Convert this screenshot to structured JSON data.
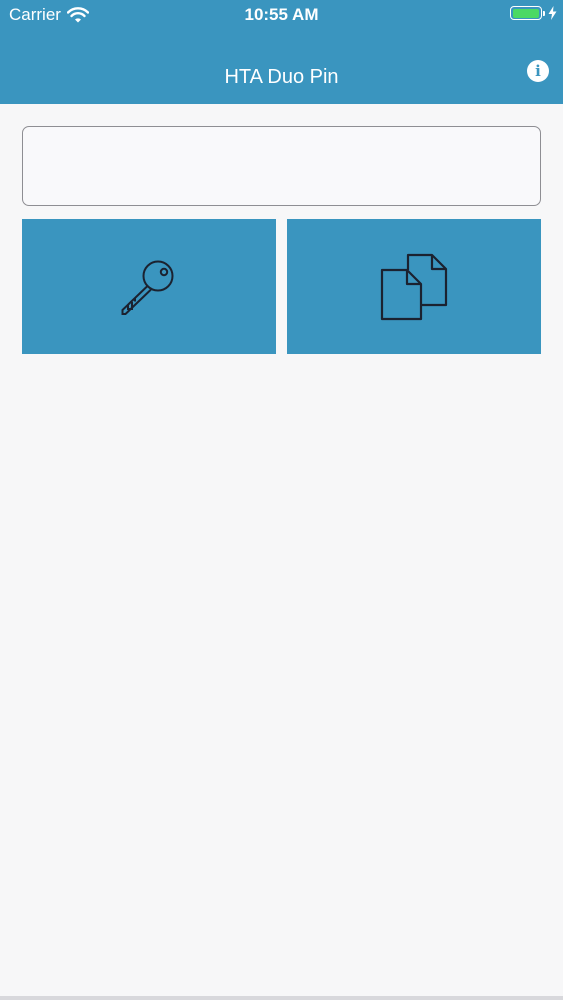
{
  "status_bar": {
    "carrier": "Carrier",
    "time": "10:55 AM",
    "battery_level": 1.0,
    "battery_color": "#4cd964",
    "wifi_icon": "wifi-icon",
    "charging_icon": "bolt-icon"
  },
  "nav": {
    "title": "HTA Duo Pin",
    "info_icon": "info-icon",
    "info_glyph": "i",
    "background_color": "#3a95bf"
  },
  "pin_input": {
    "value": "",
    "placeholder": ""
  },
  "actions": [
    {
      "icon": "key-icon"
    },
    {
      "icon": "copy-icon"
    }
  ],
  "colors": {
    "accent": "#3a95bf",
    "page_background": "#f7f7f8",
    "icon_stroke": "#1b2230"
  }
}
